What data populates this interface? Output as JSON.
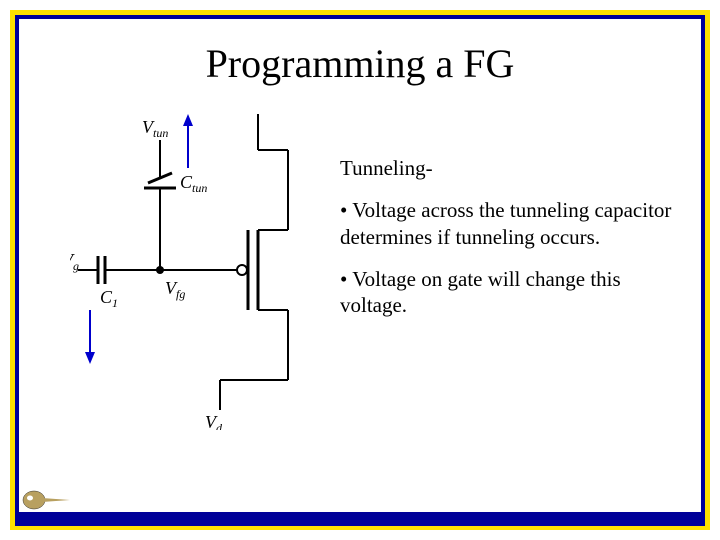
{
  "title": "Programming a FG",
  "circuit": {
    "labels": {
      "vtun": "V",
      "vtun_sub": "tun",
      "ctun": "C",
      "ctun_sub": "tun",
      "vg": "V",
      "vg_sub": "g",
      "c1": "C",
      "c1_sub": "1",
      "vfg": "V",
      "vfg_sub": "fg",
      "vd": "V",
      "vd_sub": "d"
    }
  },
  "text": {
    "heading": "Tunneling-",
    "bullet1": "• Voltage across the tunneling capacitor determines if tunneling occurs.",
    "bullet2": "• Voltage on gate will change this voltage."
  }
}
